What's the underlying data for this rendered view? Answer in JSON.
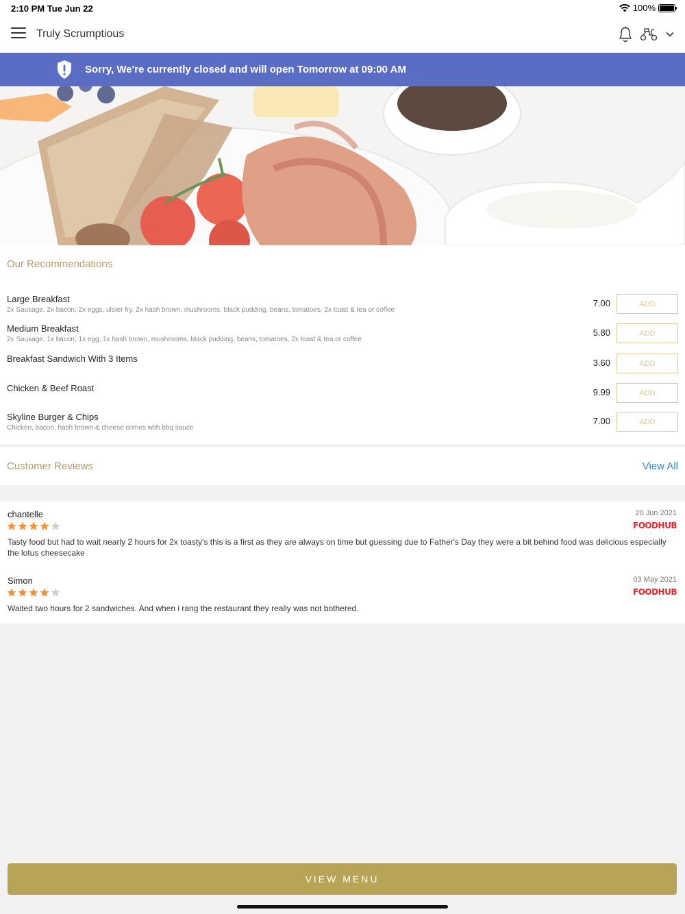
{
  "status_bar": {
    "time": "2:10 PM  Tue Jun 22",
    "battery": "100%"
  },
  "header": {
    "title": "Truly Scrumptious"
  },
  "banner": {
    "text": "Sorry, We're currently closed and will open Tomorrow at 09:00 AM",
    "color": "#5b6dc2"
  },
  "recommendations": {
    "title": "Our Recommendations",
    "add_label": "ADD",
    "items": [
      {
        "name": "Large Breakfast",
        "description": "2x Sausage, 2x bacon, 2x eggs, ulster fry, 2x hash brown, mushrooms, black pudding, beans, tomatoes, 2x toast & tea or coffee",
        "price": "7.00"
      },
      {
        "name": "Medium Breakfast",
        "description": "2x Sausage, 1x bacon, 1x egg, 1x hash brown, mushrooms, black pudding, beans, tomatoes, 2x toast & tea or coffee",
        "price": "5.80"
      },
      {
        "name": "Breakfast Sandwich With 3 Items",
        "description": "",
        "price": "3.60"
      },
      {
        "name": "Chicken & Beef Roast",
        "description": "",
        "price": "9.99"
      },
      {
        "name": "Skyline Burger & Chips",
        "description": "Chicken, bacon, hash brown & cheese comes with bbq sauce",
        "price": "7.00"
      }
    ]
  },
  "reviews": {
    "title": "Customer Reviews",
    "view_all": "View All",
    "items": [
      {
        "name": "chantelle",
        "date": "20 Jun 2021",
        "rating": 4,
        "source": "FOODHUB",
        "text": "Tasty food but had to wait nearly 2 hours for 2x toasty's this is a first as they are always on time but guessing due to Father's Day they were a bit behind food was delicious especially the lotus cheesecake"
      },
      {
        "name": "Simon",
        "date": "03 May 2021",
        "rating": 4,
        "source": "FOODHUB",
        "text": "Waited two hours for 2 sandwiches. And when i rang the restaurant they really was not bothered."
      }
    ]
  },
  "footer": {
    "button_label": "VIEW MENU",
    "color": "#b8a456"
  },
  "colors": {
    "accent_gold": "#b09a6a",
    "link_blue": "#2a8cc7",
    "star_orange": "#f0913a",
    "foodhub_red": "#e0282e"
  }
}
